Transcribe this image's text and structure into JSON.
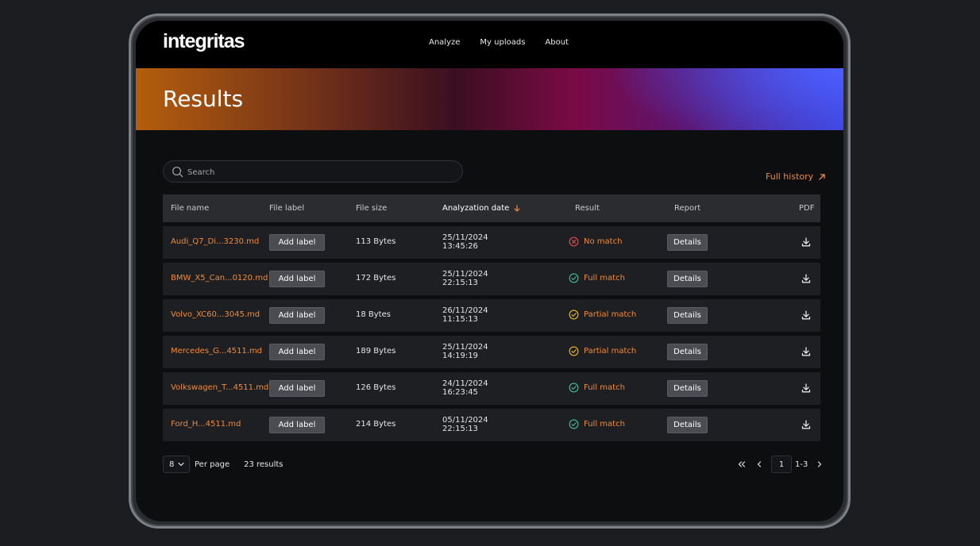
{
  "app": {
    "logo": "integritas",
    "nav": [
      "Analyze",
      "My uploads",
      "About"
    ]
  },
  "page": {
    "title": "Results"
  },
  "search": {
    "placeholder": "Search",
    "value": ""
  },
  "full_history": "Full history",
  "table": {
    "columns": [
      "File name",
      "File label",
      "File size",
      "Analyzation date",
      "Result",
      "Report",
      "PDF"
    ],
    "sorted_column": "Analyzation date",
    "sort_direction": "descending",
    "rows": [
      {
        "file": "Audi_Q7_Di...3230.md",
        "label_btn": "Add label",
        "size": "113 Bytes",
        "date": "25/11/2024",
        "time": "13:45:26",
        "result": "No match",
        "result_icon": "x-circle-icon",
        "report_btn": "Details"
      },
      {
        "file": "BMW_X5_Can...0120.md",
        "label_btn": "Add label",
        "size": "172 Bytes",
        "date": "25/11/2024",
        "time": "22:15:13",
        "result": "Full match",
        "result_icon": "check-circle-icon",
        "report_btn": "Details"
      },
      {
        "file": "Volvo_XC60...3045.md",
        "label_btn": "Add label",
        "size": "18 Bytes",
        "date": "26/11/2024",
        "time": "11:15:13",
        "result": "Partial match",
        "result_icon": "check-circle-icon",
        "report_btn": "Details"
      },
      {
        "file": "Mercedes_G...4511.md",
        "label_btn": "Add label",
        "size": "189 Bytes",
        "date": "25/11/2024",
        "time": "14:19:19",
        "result": "Partial match",
        "result_icon": "check-circle-icon",
        "report_btn": "Details"
      },
      {
        "file": "Volkswagen_T...4511.md",
        "label_btn": "Add label",
        "size": "126 Bytes",
        "date": "24/11/2024",
        "time": "16:23:45",
        "result": "Full match",
        "result_icon": "check-circle-icon",
        "report_btn": "Details"
      },
      {
        "file": "Ford_H...4511.md",
        "label_btn": "Add label",
        "size": "214 Bytes",
        "date": "05/11/2024",
        "time": "22:15:13",
        "result": "Full match",
        "result_icon": "check-circle-icon",
        "report_btn": "Details"
      }
    ]
  },
  "pagination": {
    "per_page_value": "8",
    "per_page_label": "Per page",
    "results_count": "23 results",
    "current_page": "1",
    "range": "1-3"
  },
  "colors": {
    "accent": "#f08a3c",
    "no_match": "#e5484d",
    "full_match": "#3fbf8f",
    "partial_match": "#f0b429",
    "row_bg": "#1d1f23",
    "header_bg": "#2a2c30"
  }
}
